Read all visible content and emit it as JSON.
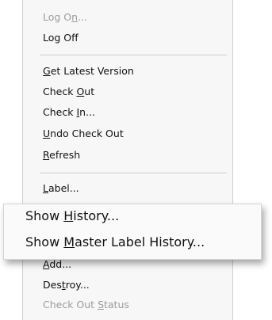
{
  "menu": {
    "log_on": {
      "pre": "Log O",
      "acc": "n",
      "post": "..."
    },
    "log_off": {
      "pre": "Log Of",
      "acc": "f",
      "post": ""
    },
    "get_latest": {
      "pre": "",
      "acc": "G",
      "post": "et Latest Version"
    },
    "check_out": {
      "pre": "Check ",
      "acc": "O",
      "post": "ut"
    },
    "check_in": {
      "pre": "Check ",
      "acc": "I",
      "post": "n..."
    },
    "undo_check_out": {
      "pre": "",
      "acc": "U",
      "post": "ndo Check Out"
    },
    "refresh": {
      "pre": "",
      "acc": "R",
      "post": "efresh"
    },
    "label": {
      "pre": "",
      "acc": "L",
      "post": "abel..."
    },
    "add": {
      "pre": "",
      "acc": "A",
      "post": "dd..."
    },
    "destroy": {
      "pre": "Des",
      "acc": "t",
      "post": "roy..."
    },
    "check_out_status": {
      "pre": "Check Out ",
      "acc": "S",
      "post": "tatus"
    }
  },
  "zoomed": {
    "show_history": {
      "pre": "Show ",
      "acc": "H",
      "post": "istory..."
    },
    "show_master_label_history": {
      "pre": "Show ",
      "acc": "M",
      "post": "aster Label History..."
    }
  }
}
